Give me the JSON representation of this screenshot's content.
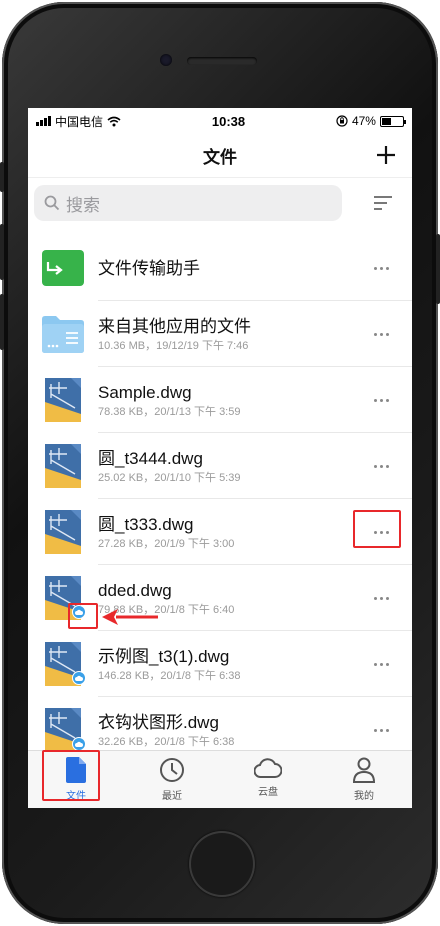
{
  "status_bar": {
    "carrier": "中国电信",
    "time": "10:38",
    "battery": "47%"
  },
  "nav": {
    "title": "文件",
    "add_icon": "plus-icon"
  },
  "search": {
    "placeholder": "搜索",
    "icon": "search-icon",
    "sort_icon": "sort-icon"
  },
  "files": [
    {
      "name": "文件传输助手",
      "meta": "",
      "icon": "green-folder-icon"
    },
    {
      "name": "来自其他应用的文件",
      "meta": "10.36 MB，19/12/19 下午 7:46",
      "icon": "blue-folder-icon"
    },
    {
      "name": "Sample.dwg",
      "meta": "78.38 KB，20/1/13 下午 3:59",
      "icon": "dwg-file-icon"
    },
    {
      "name": "圆_t3444.dwg",
      "meta": "25.02 KB，20/1/10 下午 5:39",
      "icon": "dwg-file-icon"
    },
    {
      "name": "圆_t333.dwg",
      "meta": "27.28 KB，20/1/9 下午 3:00",
      "icon": "dwg-file-icon"
    },
    {
      "name": "dded.dwg",
      "meta": "79.88 KB，20/1/8 下午 6:40",
      "icon": "dwg-file-icon"
    },
    {
      "name": "示例图_t3(1).dwg",
      "meta": "146.28 KB，20/1/8 下午 6:38",
      "icon": "dwg-file-icon"
    },
    {
      "name": "衣钩状图形.dwg",
      "meta": "32.26 KB，20/1/8 下午 6:38",
      "icon": "dwg-file-icon"
    }
  ],
  "tabs": [
    {
      "label": "文件",
      "icon": "file-icon",
      "active": true
    },
    {
      "label": "最近",
      "icon": "clock-icon",
      "active": false
    },
    {
      "label": "云盘",
      "icon": "cloud-icon",
      "active": false
    },
    {
      "label": "我的",
      "icon": "person-icon",
      "active": false
    }
  ],
  "colors": {
    "accent": "#2a6fe0",
    "annotation": "#e8282b",
    "cloud_badge": "#3aa0e8",
    "folder_green": "#37b34a",
    "folder_blue": "#8cc8f0",
    "dwg_blue": "#3f6fa8",
    "dwg_yellow": "#f0bc45"
  }
}
